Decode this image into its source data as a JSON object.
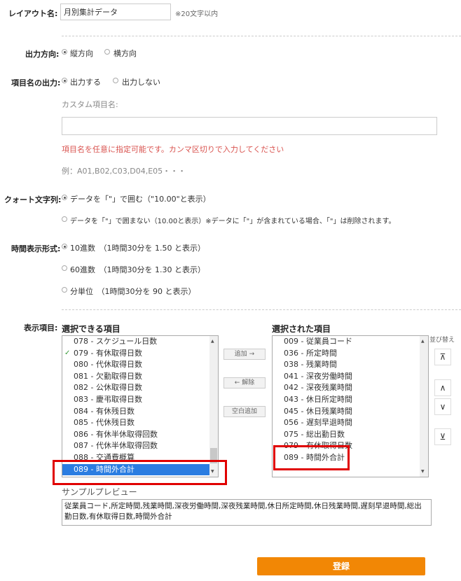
{
  "layout_name": {
    "label": "レイアウト名:",
    "value": "月別集計データ",
    "hint": "※20文字以内"
  },
  "output_direction": {
    "label": "出力方向:",
    "opt1": "縦方向",
    "opt2": "横方向"
  },
  "header_output": {
    "label": "項目名の出力:",
    "opt1": "出力する",
    "opt2": "出力しない",
    "custom_label": "カスタム項目名:",
    "warning": "項目名を任意に指定可能です。カンマ区切りで入力してください",
    "example": "例：A01,B02,C03,D04,E05・・・"
  },
  "quote": {
    "label": "クォート文字列:",
    "opt1": "データを「\"」で囲む（\"10.00\"と表示）",
    "opt2": "データを「\"」で囲まない（10.00と表示）※データに「\"」が含まれている場合、「\"」は削除されます。"
  },
  "time_format": {
    "label": "時間表示形式:",
    "opt1": "10進数　（1時間30分を 1.50 と表示）",
    "opt2": "60進数　（1時間30分を 1.30 と表示）",
    "opt3": "分単位　（1時間30分を 90 と表示）"
  },
  "display_items": {
    "label": "表示項目:",
    "available_title": "選択できる項目",
    "selected_title": "選択された項目",
    "available": [
      {
        "text": "078 - スケジュール日数",
        "checked": false,
        "selected": false
      },
      {
        "text": "079 - 有休取得日数",
        "checked": true,
        "selected": false
      },
      {
        "text": "080 - 代休取得日数",
        "checked": false,
        "selected": false
      },
      {
        "text": "081 - 欠勤取得日数",
        "checked": false,
        "selected": false
      },
      {
        "text": "082 - 公休取得日数",
        "checked": false,
        "selected": false
      },
      {
        "text": "083 - 慶弔取得日数",
        "checked": false,
        "selected": false
      },
      {
        "text": "084 - 有休残日数",
        "checked": false,
        "selected": false
      },
      {
        "text": "085 - 代休残日数",
        "checked": false,
        "selected": false
      },
      {
        "text": "086 - 有休半休取得回数",
        "checked": false,
        "selected": false
      },
      {
        "text": "087 - 代休半休取得回数",
        "checked": false,
        "selected": false
      },
      {
        "text": "088 - 交通費概算",
        "checked": false,
        "selected": false
      },
      {
        "text": "089 - 時間外合計",
        "checked": false,
        "selected": true
      }
    ],
    "selected": [
      "009 - 従業員コード",
      "036 - 所定時間",
      "038 - 残業時間",
      "041 - 深夜労働時間",
      "042 - 深夜残業時間",
      "043 - 休日所定時間",
      "045 - 休日残業時間",
      "056 - 遅刻早退時間",
      "075 - 総出勤日数",
      "079 - 有休取得日数",
      "089 - 時間外合計"
    ],
    "add_label": "追加 →",
    "remove_label": "← 解除",
    "blank_label": "空白追加",
    "sort_label": "並び替え",
    "sort_top": "⊼",
    "sort_up": "∧",
    "sort_down": "∨",
    "sort_bottom": "⊻"
  },
  "preview": {
    "label": "サンプルプレビュー",
    "text": "従業員コード,所定時間,残業時間,深夜労働時間,深夜残業時間,休日所定時間,休日残業時間,遅刻早退時間,総出勤日数,有休取得日数,時間外合計"
  },
  "submit_label": "登録",
  "colors": {
    "accent": "#f28705",
    "highlight": "#e00000",
    "selected": "#2b7de1",
    "warning": "#d9534f"
  }
}
